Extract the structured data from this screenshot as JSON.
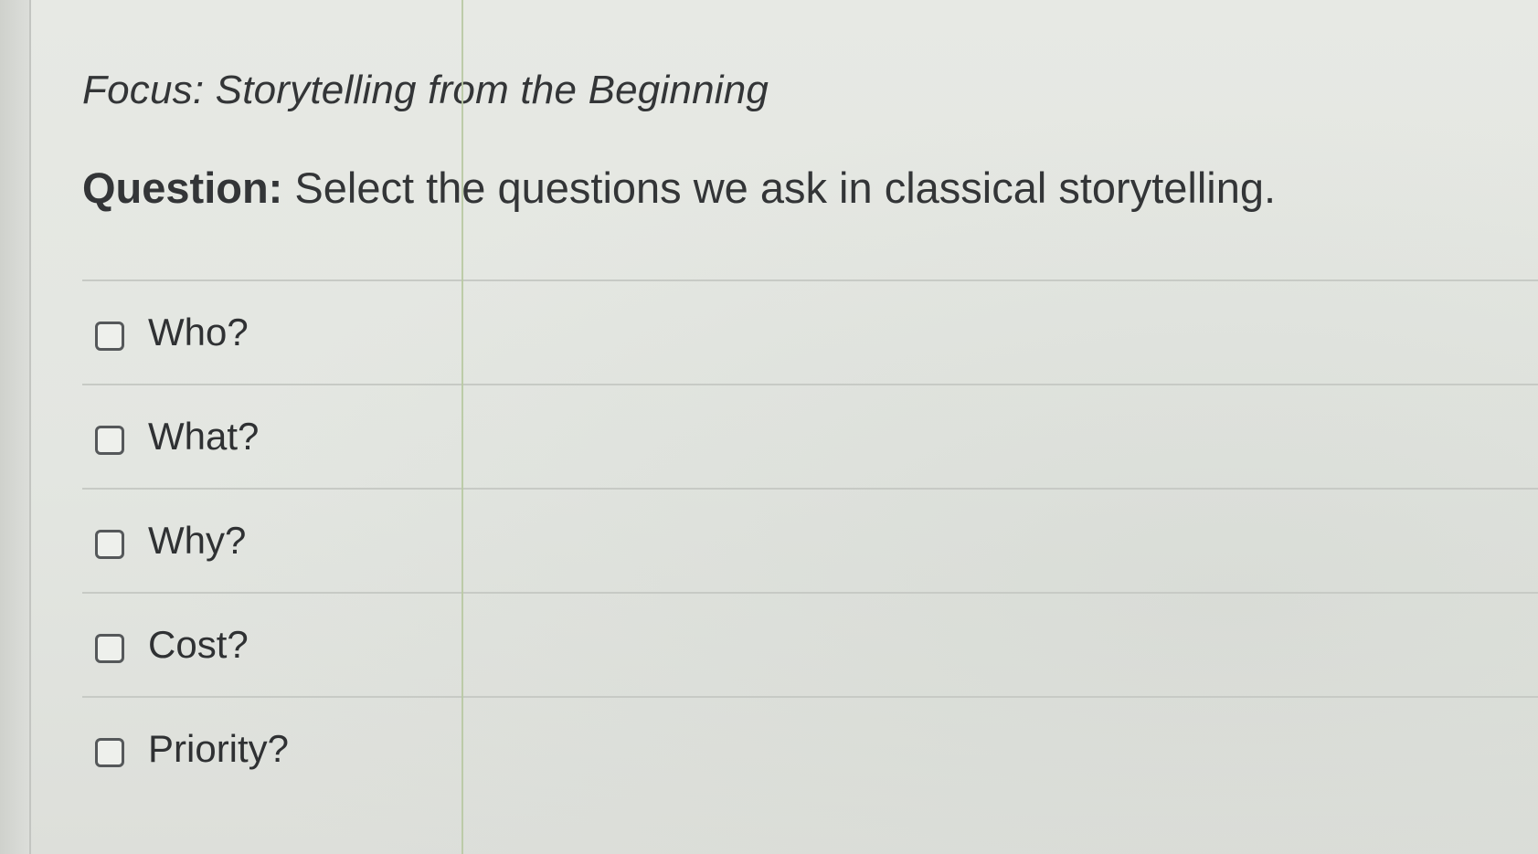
{
  "focus": {
    "text": "Focus: Storytelling from the Beginning"
  },
  "question": {
    "label": "Question:",
    "text": " Select the questions we ask in classical storytelling."
  },
  "options": [
    {
      "label": "Who?",
      "checked": false
    },
    {
      "label": "What?",
      "checked": false
    },
    {
      "label": "Why?",
      "checked": false
    },
    {
      "label": "Cost?",
      "checked": false
    },
    {
      "label": "Priority?",
      "checked": false
    }
  ]
}
